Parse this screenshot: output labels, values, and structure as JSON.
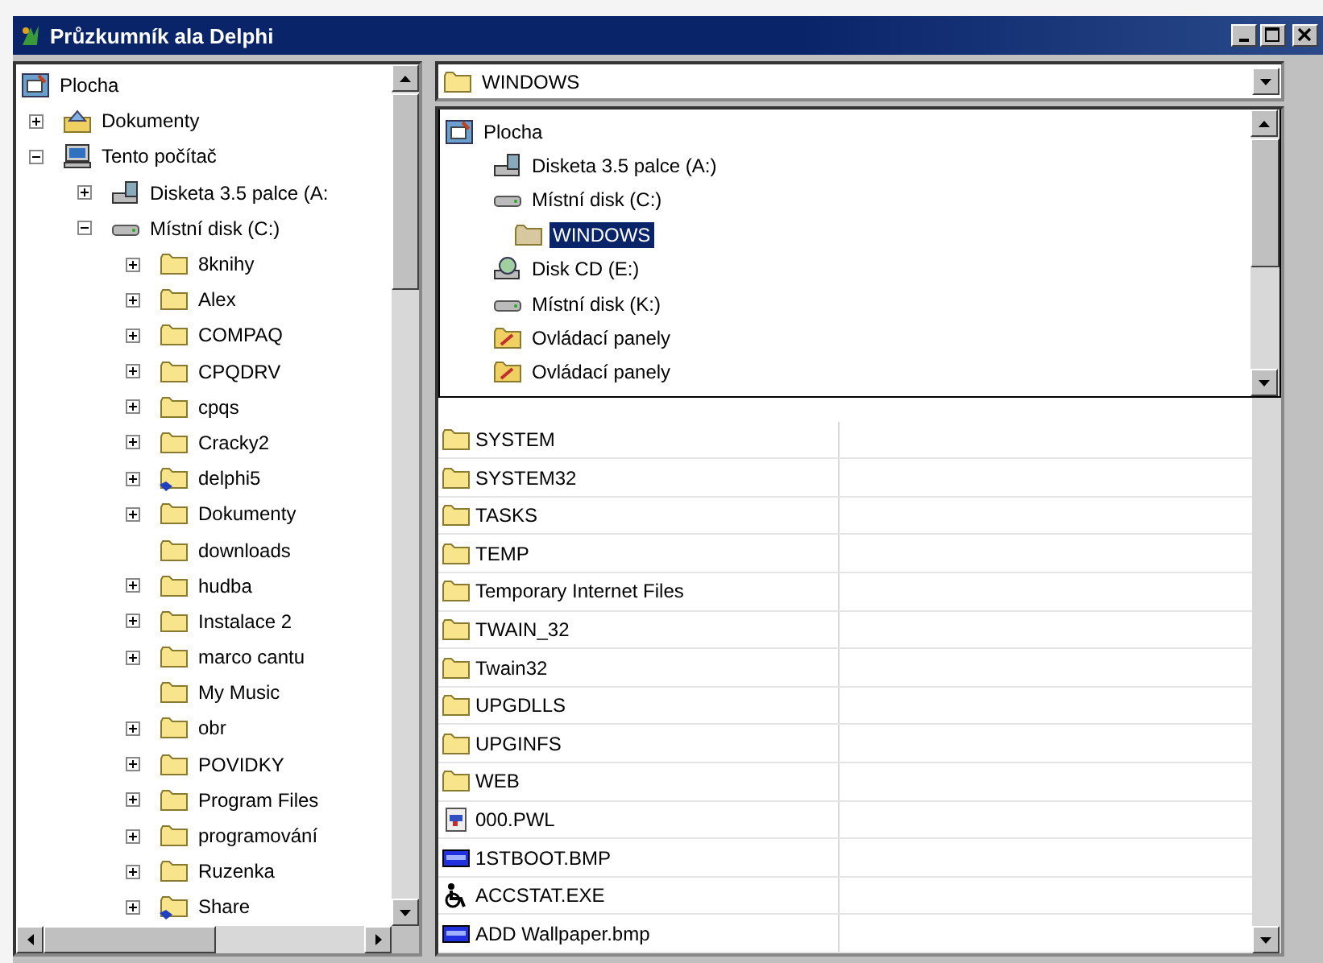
{
  "window": {
    "title": "Průzkumník ala Delphi"
  },
  "tree": [
    {
      "label": "Plocha",
      "kind": "desktop",
      "children": [
        {
          "label": "Dokumenty",
          "kind": "documents",
          "has_children": true,
          "expanded": false
        },
        {
          "label": "Tento počítač",
          "kind": "computer",
          "has_children": true,
          "expanded": true,
          "children": [
            {
              "label": "Disketa 3.5 palce (A:",
              "kind": "floppy",
              "has_children": true,
              "expanded": false
            },
            {
              "label": "Místní disk (C:)",
              "kind": "drive",
              "has_children": true,
              "expanded": true,
              "children": [
                {
                  "label": "8knihy",
                  "kind": "folder",
                  "has_children": true,
                  "expanded": false
                },
                {
                  "label": "Alex",
                  "kind": "folder",
                  "has_children": true,
                  "expanded": false
                },
                {
                  "label": "COMPAQ",
                  "kind": "folder",
                  "has_children": true,
                  "expanded": false
                },
                {
                  "label": "CPQDRV",
                  "kind": "folder",
                  "has_children": true,
                  "expanded": false
                },
                {
                  "label": "cpqs",
                  "kind": "folder",
                  "has_children": true,
                  "expanded": false
                },
                {
                  "label": "Cracky2",
                  "kind": "folder",
                  "has_children": true,
                  "expanded": false
                },
                {
                  "label": "delphi5",
                  "kind": "shared-folder",
                  "has_children": true,
                  "expanded": false
                },
                {
                  "label": "Dokumenty",
                  "kind": "folder",
                  "has_children": true,
                  "expanded": false
                },
                {
                  "label": "downloads",
                  "kind": "folder",
                  "has_children": false
                },
                {
                  "label": "hudba",
                  "kind": "folder",
                  "has_children": true,
                  "expanded": false
                },
                {
                  "label": "Instalace 2",
                  "kind": "folder",
                  "has_children": true,
                  "expanded": false
                },
                {
                  "label": "marco cantu",
                  "kind": "folder",
                  "has_children": true,
                  "expanded": false
                },
                {
                  "label": "My Music",
                  "kind": "folder",
                  "has_children": false
                },
                {
                  "label": "obr",
                  "kind": "folder",
                  "has_children": true,
                  "expanded": false
                },
                {
                  "label": "POVIDKY",
                  "kind": "folder",
                  "has_children": true,
                  "expanded": false
                },
                {
                  "label": "Program Files",
                  "kind": "folder",
                  "has_children": true,
                  "expanded": false
                },
                {
                  "label": "programování",
                  "kind": "folder",
                  "has_children": true,
                  "expanded": false
                },
                {
                  "label": "Ruzenka",
                  "kind": "folder",
                  "has_children": true,
                  "expanded": false
                },
                {
                  "label": "Share",
                  "kind": "shared-folder",
                  "has_children": true,
                  "expanded": false
                }
              ]
            }
          ]
        }
      ]
    }
  ],
  "path_combo": {
    "value": "WINDOWS",
    "kind": "folder"
  },
  "path_dropdown": [
    {
      "label": "Plocha",
      "kind": "desktop",
      "selected": false,
      "children": [
        {
          "label": "Disketa 3.5 palce (A:)",
          "kind": "floppy",
          "selected": false
        },
        {
          "label": "Místní disk (C:)",
          "kind": "drive",
          "selected": false,
          "children": [
            {
              "label": "WINDOWS",
              "kind": "open-folder",
              "selected": true
            }
          ]
        },
        {
          "label": "Disk CD (E:)",
          "kind": "cd",
          "selected": false
        },
        {
          "label": "Místní disk (K:)",
          "kind": "drive",
          "selected": false
        },
        {
          "label": "Ovládací panely",
          "kind": "control-panel",
          "selected": false
        },
        {
          "label": "Ovládací panely",
          "kind": "control-panel",
          "selected": false
        }
      ]
    }
  ],
  "files": [
    {
      "name": "SYSTEM",
      "kind": "folder"
    },
    {
      "name": "SYSTEM32",
      "kind": "folder"
    },
    {
      "name": "TASKS",
      "kind": "folder"
    },
    {
      "name": "TEMP",
      "kind": "folder"
    },
    {
      "name": "Temporary Internet Files",
      "kind": "folder"
    },
    {
      "name": "TWAIN_32",
      "kind": "folder"
    },
    {
      "name": "Twain32",
      "kind": "folder"
    },
    {
      "name": "UPGDLLS",
      "kind": "folder"
    },
    {
      "name": "UPGINFS",
      "kind": "folder"
    },
    {
      "name": "WEB",
      "kind": "folder"
    },
    {
      "name": "000.PWL",
      "kind": "pwl"
    },
    {
      "name": "1STBOOT.BMP",
      "kind": "bmp"
    },
    {
      "name": "ACCSTAT.EXE",
      "kind": "exe"
    },
    {
      "name": "ADD Wallpaper.bmp",
      "kind": "bmp"
    }
  ]
}
